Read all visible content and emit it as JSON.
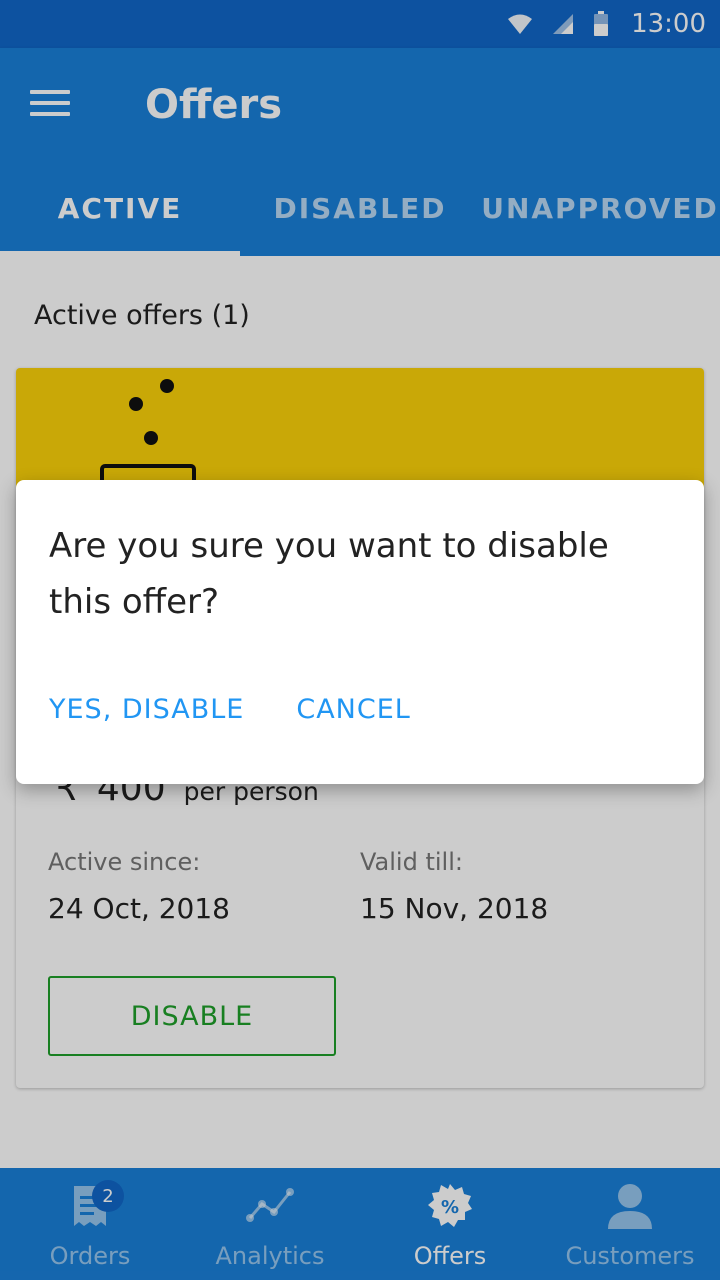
{
  "status_bar": {
    "time": "13:00",
    "icons": [
      "wifi-icon",
      "signal-icon",
      "battery-icon"
    ]
  },
  "app_bar": {
    "title": "Offers",
    "menu_icon": "menu-icon"
  },
  "tabs": [
    {
      "label": "ACTIVE",
      "selected": true
    },
    {
      "label": "DISABLED",
      "selected": false
    },
    {
      "label": "UNAPPROVED",
      "selected": false
    }
  ],
  "content": {
    "heading": "Active offers (1)",
    "offer": {
      "currency_symbol": "₹",
      "price": "400",
      "price_unit": "per person",
      "active_since_label": "Active since:",
      "active_since": "24 Oct, 2018",
      "valid_till_label": "Valid till:",
      "valid_till": "15 Nov, 2018",
      "disable_label": "DISABLE"
    }
  },
  "dialog": {
    "message": "Are you sure you want to disable this offer?",
    "confirm_label": "YES, DISABLE",
    "cancel_label": "CANCEL"
  },
  "bottom_nav": {
    "items": [
      {
        "label": "Orders",
        "icon": "receipt-icon",
        "badge": "2",
        "selected": false
      },
      {
        "label": "Analytics",
        "icon": "analytics-icon",
        "selected": false
      },
      {
        "label": "Offers",
        "icon": "percent-badge-icon",
        "selected": true
      },
      {
        "label": "Customers",
        "icon": "person-icon",
        "selected": false
      }
    ]
  },
  "colors": {
    "primary": "#1a80d9",
    "primary_dark": "#1167c8",
    "banner": "#fcd209",
    "accent_button": "#2196f3",
    "disable_green": "#1f9f2a"
  }
}
